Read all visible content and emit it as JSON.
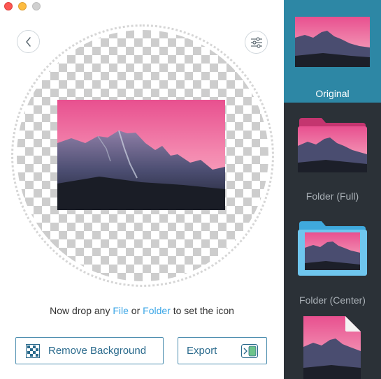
{
  "window": {
    "controls": [
      "close",
      "minimize",
      "zoom"
    ]
  },
  "toolbar": {
    "back_icon": "chevron-left-icon",
    "settings_icon": "sliders-icon"
  },
  "drop_zone": {
    "hint_prefix": "Now drop any ",
    "hint_file": "File",
    "hint_or": " or ",
    "hint_folder": "Folder",
    "hint_suffix": " to set the icon"
  },
  "actions": {
    "remove_background_label": "Remove Background",
    "export_label": "Export"
  },
  "sidebar": {
    "items": [
      {
        "label": "Original",
        "selected": true
      },
      {
        "label": "Folder (Full)",
        "selected": false
      },
      {
        "label": "Folder (Center)",
        "selected": false
      },
      {
        "label": "",
        "selected": false
      }
    ]
  },
  "colors": {
    "accent": "#2d87a5",
    "link": "#3ba6e6",
    "sidebar_bg": "#2b3137",
    "folder_pink": "#e05a96",
    "folder_blue": "#5cbcea"
  }
}
